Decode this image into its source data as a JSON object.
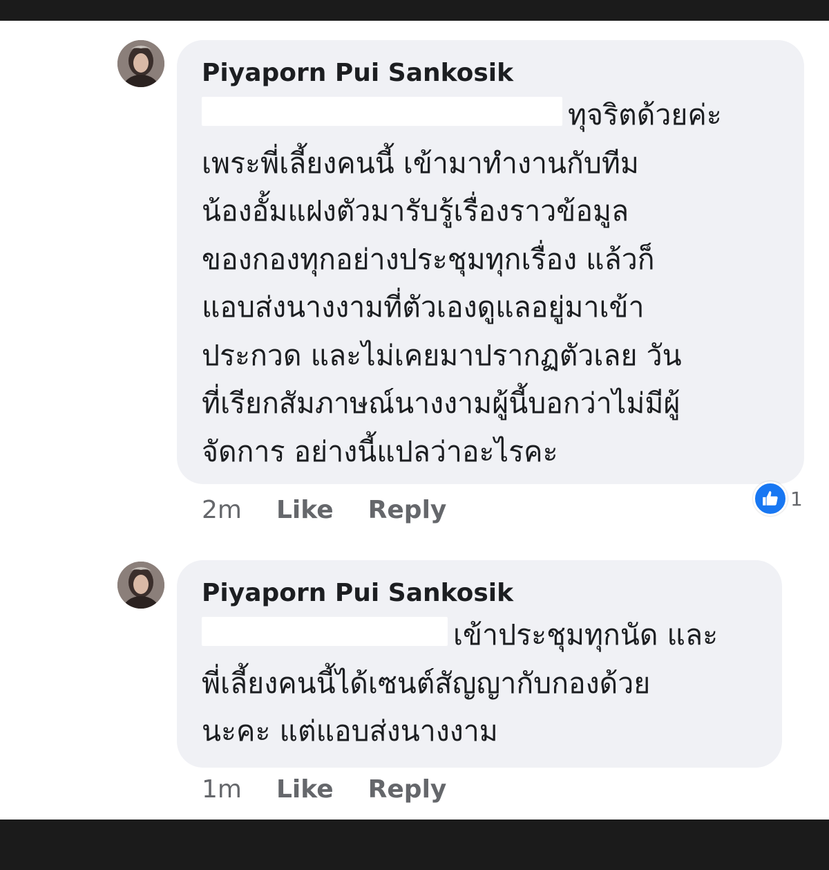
{
  "comments": [
    {
      "author": "Piyaporn Pui Sankosik",
      "avatar_icon": "profile-photo",
      "lines": [
        "ทุจริตด้วยค่ะ",
        "เพระพี่เลี้ยงคนนี้ เข้ามาทำงานกับทีม",
        "น้องอั้มแฝงตัวมารับรู้เรื่องราวข้อมูล",
        "ของกองทุกอย่างประชุมทุกเรื่อง แล้วก็",
        "แอบส่งนางงามที่ตัวเองดูแลอยู่มาเข้า",
        "ประกวด และไม่เคยมาปรากฏตัวเลย วัน",
        "ที่เรียกสัมภาษณ์นางงามผู้นี้บอกว่าไม่มีผู้",
        "จัดการ อย่างนี้แปลว่าอะไรคะ"
      ],
      "time": "2m",
      "like_label": "Like",
      "reply_label": "Reply",
      "reaction_icon": "thumbs-up-icon",
      "reaction_count": "1"
    },
    {
      "author": "Piyaporn Pui Sankosik",
      "avatar_icon": "profile-photo",
      "lines": [
        "เข้าประชุมทุกนัด และ",
        "พี่เลี้ยงคนนี้ได้เซนต์สัญญากับกองด้วย",
        "นะคะ แต่แอบส่งนางงาม"
      ],
      "time": "1m",
      "like_label": "Like",
      "reply_label": "Reply"
    }
  ],
  "colors": {
    "bubble": "#f0f1f5",
    "text": "#1c1e21",
    "meta": "#65676b",
    "reaction": "#1877f2",
    "frame": "#1b1b1b"
  }
}
